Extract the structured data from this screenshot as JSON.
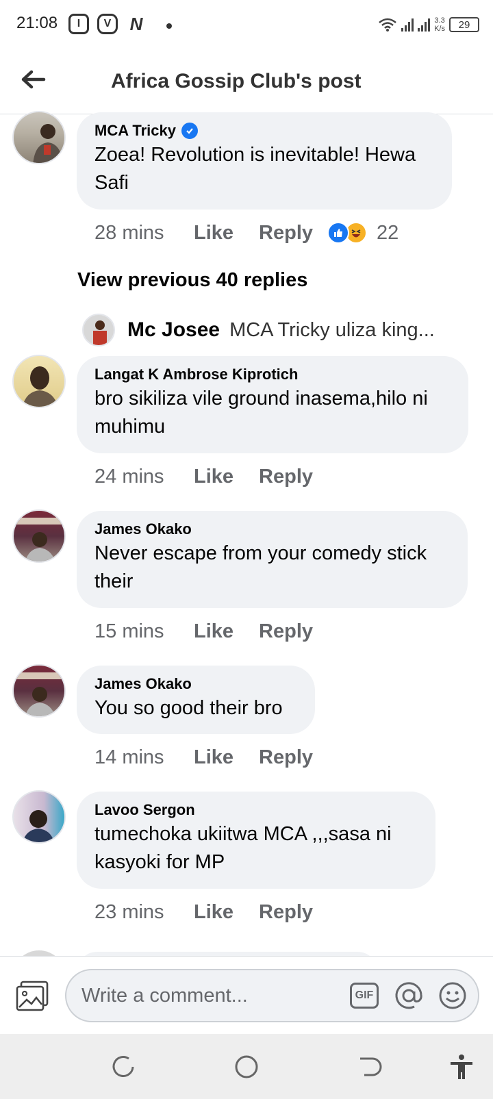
{
  "status_bar": {
    "time": "21:08",
    "apps": [
      "I",
      "V",
      "N"
    ],
    "speed_top": "3.3",
    "speed_bottom": "K/s",
    "battery": "29"
  },
  "header": {
    "title": "Africa Gossip Club's post"
  },
  "comments": [
    {
      "author": "MCA Tricky",
      "verified": true,
      "text": "Zoea! Revolution is inevitable! Hewa Safi",
      "time": "28 mins",
      "like": "Like",
      "reply": "Reply",
      "reaction_count": "22"
    },
    {
      "author": "Langat K Ambrose Kiprotich",
      "text": "bro sikiliza vile ground inasema,hilo ni muhimu",
      "time": "24 mins",
      "like": "Like",
      "reply": "Reply"
    },
    {
      "author": "James Okako",
      "text": "Never escape from your comedy stick their",
      "time": "15 mins",
      "like": "Like",
      "reply": "Reply"
    },
    {
      "author": "James Okako",
      "text": "You so good their bro",
      "time": "14 mins",
      "like": "Like",
      "reply": "Reply"
    },
    {
      "author": "Lavoo Sergon",
      "text": "tumechoka ukiitwa MCA ,,,sasa ni kasyoki for MP",
      "time": "23 mins",
      "like": "Like",
      "reply": "Reply"
    }
  ],
  "view_previous": "View previous 40 replies",
  "reply_preview": {
    "name": "Mc Josee",
    "text": "MCA Tricky uliza king..."
  },
  "composer": {
    "placeholder": "Write a comment...",
    "gif_label": "GIF"
  },
  "colors": {
    "bubble": "#f0f2f5",
    "meta_text": "#65676b",
    "brand_blue": "#1877f2",
    "haha_yellow": "#f7b125"
  },
  "icons": [
    "back-arrow-icon",
    "verified-badge-icon",
    "like-reaction-icon",
    "haha-reaction-icon",
    "photo-icon",
    "gif-icon",
    "at-mention-icon",
    "emoji-icon",
    "recents-icon",
    "home-icon",
    "back-nav-icon",
    "accessibility-icon"
  ]
}
